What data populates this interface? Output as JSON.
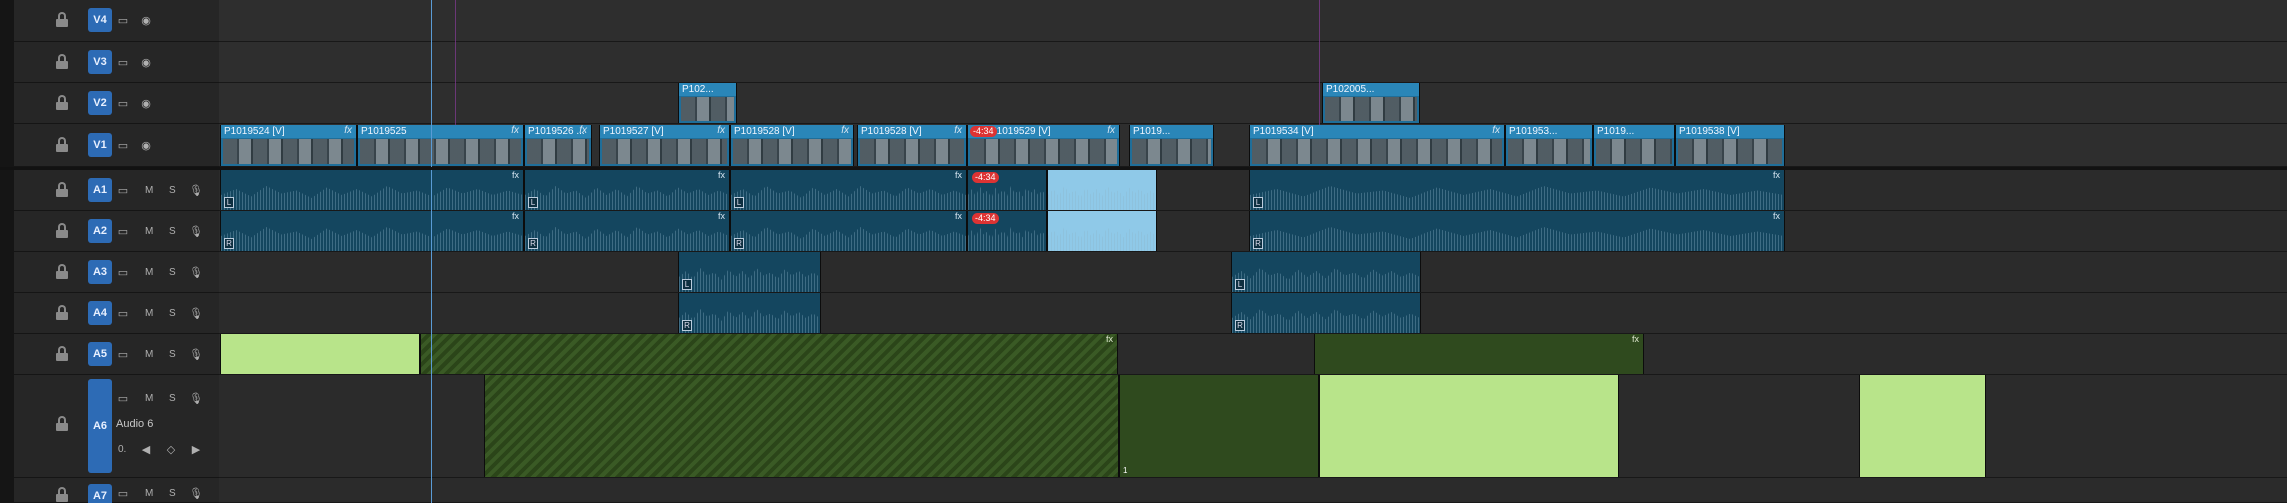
{
  "tracks": [
    {
      "id": "V4",
      "kind": "video"
    },
    {
      "id": "V3",
      "kind": "video"
    },
    {
      "id": "V2",
      "kind": "video"
    },
    {
      "id": "V1",
      "kind": "video"
    },
    {
      "id": "A1",
      "kind": "audio"
    },
    {
      "id": "A2",
      "kind": "audio"
    },
    {
      "id": "A3",
      "kind": "audio"
    },
    {
      "id": "A4",
      "kind": "audio"
    },
    {
      "id": "A5",
      "kind": "audio"
    },
    {
      "id": "A6",
      "kind": "audio",
      "name": "Audio 6",
      "volume_label": "0."
    },
    {
      "id": "A7",
      "kind": "audio"
    }
  ],
  "buttons": {
    "mute": "M",
    "solo": "S"
  },
  "v2_clips": [
    "P102...",
    "P102005..."
  ],
  "v1_clips": [
    "P1019524 [V]",
    "P1019525",
    "P1019526 ...",
    "P1019527 [V]",
    "P1019528 [V]",
    "P1019528 [V]",
    "P1019529 [V]",
    "P1019...",
    "P1019534 [V]",
    "P101953...",
    "P1019...",
    "P1019538 [V]"
  ],
  "badges": {
    "speed": "-4:34",
    "speed_audio_1": "-4:34",
    "speed_audio_2": "-4:34"
  },
  "channel_labels": {
    "left": "L",
    "right": "R",
    "one": "1"
  },
  "fx_label": "fx",
  "icons": [
    "lock-icon",
    "film-icon",
    "eye-icon",
    "microphone-icon",
    "keyframe-prev-icon",
    "keyframe-add-icon",
    "keyframe-next-icon"
  ],
  "colors": {
    "video_clip": "#1f6e99",
    "audio_clip": "#14465f",
    "green_clip": "#2f4a1e",
    "light_green": "#b8e48a",
    "target_blue": "#2d6bb5",
    "playhead": "#5a9bd5"
  }
}
